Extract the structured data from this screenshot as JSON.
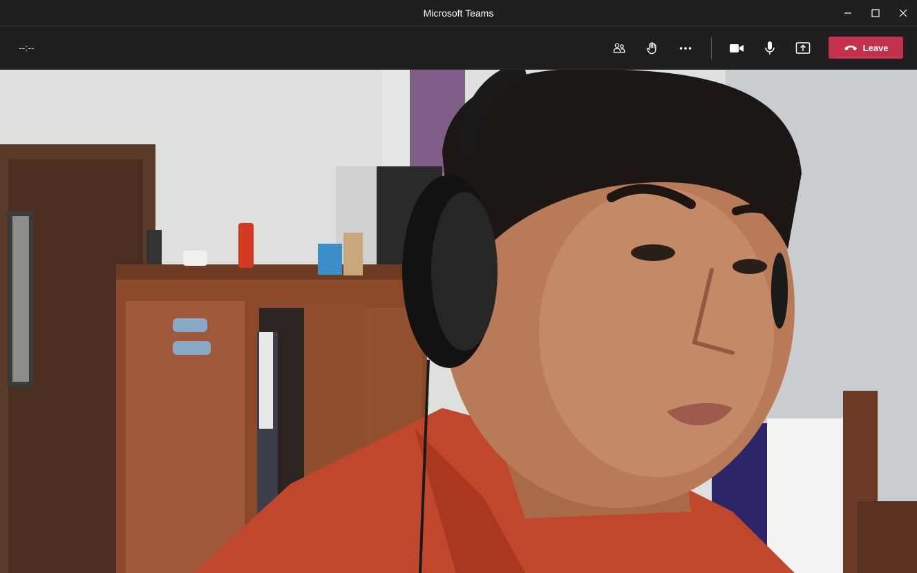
{
  "window": {
    "title": "Microsoft Teams",
    "controls": [
      "minimize-icon",
      "maximize-icon",
      "close-icon"
    ]
  },
  "meeting": {
    "timer": "--:--",
    "buttons": [
      {
        "name": "participants-button",
        "icon": "people-icon"
      },
      {
        "name": "raise-hand-button",
        "icon": "hand-icon"
      },
      {
        "name": "more-actions-button",
        "icon": "ellipsis-icon"
      },
      {
        "name": "camera-button",
        "icon": "video-camera-icon"
      },
      {
        "name": "mic-button",
        "icon": "microphone-icon"
      },
      {
        "name": "share-screen-button",
        "icon": "share-tray-icon"
      }
    ],
    "leave_label": "Leave",
    "leave_color": "#c4314b"
  },
  "video": {
    "content": "participant-camera-feed"
  }
}
